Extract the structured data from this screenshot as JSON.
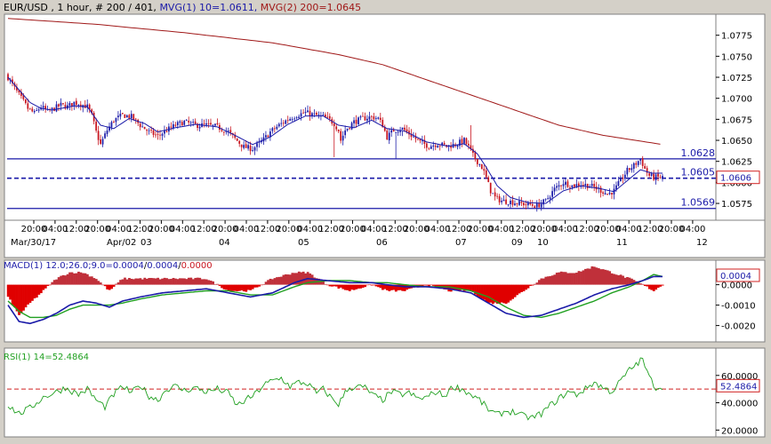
{
  "colors": {
    "frame": "#d4d0c8",
    "plot_bg": "#ffffff",
    "bull": "#1a1aa8",
    "bear": "#c8141e",
    "mvg1": "#1a1aa8",
    "mvg2": "#a01818",
    "hline": "#1a1aa8",
    "macd_line": "#1a1aa8",
    "signal_line": "#20a020",
    "hist_pos": "#c0303a",
    "hist_neg": "#e00000",
    "rsi_line": "#20a020",
    "rsi_ref": "#d02020",
    "title_black": "#000000",
    "title_blue": "#1a1aa8",
    "title_red": "#a01818"
  },
  "header": {
    "symbol_text": "EUR/USD , 1 hour, # 200 / 401, ",
    "mvg1_text": "MVG(1) 10=1.0611, ",
    "mvg2_text": "MVG(2) 200=1.0645"
  },
  "macd_header": {
    "prefix": "MACD(1) 12.0;26.0;9.0=",
    "macd_val": "0.0004",
    "sep": "/",
    "signal_val": "0.0004",
    "sep2": "/",
    "hist_val": "0.0000"
  },
  "rsi_header": {
    "text": "RSI(1) 14=52.4864"
  },
  "x_axis": {
    "time_labels": [
      "20:00",
      "04:00",
      "12:00",
      "20:00",
      "04:00",
      "12:00",
      "20:00",
      "04:00",
      "12:00",
      "20:00",
      "04:00",
      "12:00",
      "20:00",
      "04:00",
      "12:00",
      "20:00",
      "04:00",
      "12:00",
      "20:00",
      "04:00",
      "12:00",
      "20:00",
      "04:00",
      "12:00",
      "20:00",
      "04:00",
      "12:00",
      "20:00",
      "04:00",
      "12:00",
      "20:00",
      "04:00"
    ],
    "date_labels": [
      "Mar/30/17",
      "Apr/02",
      "03",
      "04",
      "05",
      "06",
      "07",
      "09",
      "10",
      "11",
      "12"
    ]
  },
  "chart_data": [
    {
      "type": "candlestick",
      "name": "EUR/USD",
      "ylim": [
        1.0555,
        1.08
      ],
      "yticks": [
        1.0575,
        1.06,
        1.0625,
        1.065,
        1.0675,
        1.07,
        1.0725,
        1.075,
        1.0775
      ],
      "ytick_labels": [
        "1.0575",
        "1.0600",
        "1.0625",
        "1.0650",
        "1.0675",
        "1.0700",
        "1.0725",
        "1.0750",
        "1.0775"
      ],
      "last_price": 1.0606,
      "last_price_label": "1.0606",
      "levels": [
        {
          "value": 1.0628,
          "label": "1.0628",
          "style": "solid"
        },
        {
          "value": 1.0605,
          "label": "1.0605",
          "style": "dashed"
        },
        {
          "value": 1.0569,
          "label": "1.0569",
          "style": "solid"
        }
      ],
      "close_path": [
        [
          0,
          1.0725
        ],
        [
          3,
          1.0712
        ],
        [
          6,
          1.07
        ],
        [
          9,
          1.0688
        ],
        [
          12,
          1.0682
        ],
        [
          15,
          1.069
        ],
        [
          18,
          1.0684
        ],
        [
          21,
          1.0688
        ],
        [
          24,
          1.0692
        ],
        [
          27,
          1.069
        ],
        [
          30,
          1.0695
        ],
        [
          33,
          1.0693
        ],
        [
          36,
          1.069
        ],
        [
          38,
          1.068
        ],
        [
          40,
          1.066
        ],
        [
          42,
          1.0645
        ],
        [
          45,
          1.0662
        ],
        [
          48,
          1.0674
        ],
        [
          52,
          1.068
        ],
        [
          56,
          1.0678
        ],
        [
          60,
          1.0668
        ],
        [
          64,
          1.066
        ],
        [
          68,
          1.0655
        ],
        [
          72,
          1.0662
        ],
        [
          76,
          1.0668
        ],
        [
          80,
          1.0672
        ],
        [
          85,
          1.0668
        ],
        [
          90,
          1.0668
        ],
        [
          95,
          1.0666
        ],
        [
          100,
          1.066
        ],
        [
          103,
          1.0652
        ],
        [
          107,
          1.0642
        ],
        [
          111,
          1.064
        ],
        [
          115,
          1.0648
        ],
        [
          119,
          1.066
        ],
        [
          123,
          1.0668
        ],
        [
          127,
          1.0675
        ],
        [
          131,
          1.068
        ],
        [
          135,
          1.0683
        ],
        [
          139,
          1.068
        ],
        [
          143,
          1.0678
        ],
        [
          146,
          1.0674
        ],
        [
          148,
          1.067
        ],
        [
          150,
          1.0662
        ],
        [
          151,
          1.065
        ],
        [
          153,
          1.0662
        ],
        [
          157,
          1.0672
        ],
        [
          161,
          1.0676
        ],
        [
          165,
          1.0678
        ],
        [
          168,
          1.0676
        ],
        [
          170,
          1.0668
        ],
        [
          172,
          1.0654
        ],
        [
          175,
          1.0662
        ],
        [
          179,
          1.0664
        ],
        [
          183,
          1.0656
        ],
        [
          187,
          1.0648
        ],
        [
          191,
          1.0643
        ],
        [
          195,
          1.0646
        ],
        [
          199,
          1.0643
        ],
        [
          203,
          1.0645
        ],
        [
          207,
          1.065
        ],
        [
          209,
          1.0642
        ],
        [
          211,
          1.0632
        ],
        [
          213,
          1.0625
        ],
        [
          215,
          1.0618
        ],
        [
          216,
          1.0612
        ],
        [
          217,
          1.0605
        ],
        [
          219,
          1.059
        ],
        [
          221,
          1.0582
        ],
        [
          224,
          1.0578
        ],
        [
          228,
          1.0577
        ],
        [
          232,
          1.0575
        ],
        [
          236,
          1.0574
        ],
        [
          240,
          1.0572
        ],
        [
          244,
          1.0578
        ],
        [
          248,
          1.0592
        ],
        [
          252,
          1.06
        ],
        [
          256,
          1.0596
        ],
        [
          260,
          1.0598
        ],
        [
          264,
          1.0596
        ],
        [
          268,
          1.0592
        ],
        [
          272,
          1.0586
        ],
        [
          275,
          1.059
        ],
        [
          278,
          1.0602
        ],
        [
          281,
          1.0614
        ],
        [
          284,
          1.062
        ],
        [
          287,
          1.0628
        ],
        [
          289,
          1.0616
        ],
        [
          291,
          1.0608
        ],
        [
          293,
          1.0606
        ],
        [
          295,
          1.0606
        ],
        [
          297,
          1.0606
        ]
      ],
      "mvg1_path": [
        [
          0,
          1.0725
        ],
        [
          5,
          1.071
        ],
        [
          10,
          1.0695
        ],
        [
          15,
          1.0688
        ],
        [
          20,
          1.0686
        ],
        [
          30,
          1.0691
        ],
        [
          36,
          1.069
        ],
        [
          42,
          1.0668
        ],
        [
          48,
          1.0664
        ],
        [
          55,
          1.0676
        ],
        [
          62,
          1.067
        ],
        [
          68,
          1.066
        ],
        [
          76,
          1.0665
        ],
        [
          85,
          1.0669
        ],
        [
          95,
          1.0666
        ],
        [
          103,
          1.0656
        ],
        [
          111,
          1.0645
        ],
        [
          119,
          1.0654
        ],
        [
          127,
          1.0669
        ],
        [
          135,
          1.0679
        ],
        [
          143,
          1.0679
        ],
        [
          150,
          1.0668
        ],
        [
          157,
          1.0665
        ],
        [
          165,
          1.0674
        ],
        [
          172,
          1.0664
        ],
        [
          180,
          1.0661
        ],
        [
          190,
          1.0648
        ],
        [
          200,
          1.0643
        ],
        [
          207,
          1.0646
        ],
        [
          213,
          1.0634
        ],
        [
          217,
          1.0618
        ],
        [
          222,
          1.0596
        ],
        [
          228,
          1.0582
        ],
        [
          236,
          1.0576
        ],
        [
          244,
          1.0575
        ],
        [
          252,
          1.059
        ],
        [
          260,
          1.0596
        ],
        [
          268,
          1.0593
        ],
        [
          275,
          1.0589
        ],
        [
          281,
          1.0602
        ],
        [
          287,
          1.0615
        ],
        [
          292,
          1.0611
        ],
        [
          297,
          1.0611
        ]
      ],
      "mvg2_path": [
        [
          0,
          1.0795
        ],
        [
          40,
          1.0788
        ],
        [
          80,
          1.0778
        ],
        [
          120,
          1.0766
        ],
        [
          150,
          1.0752
        ],
        [
          170,
          1.074
        ],
        [
          190,
          1.0722
        ],
        [
          210,
          1.0704
        ],
        [
          230,
          1.0686
        ],
        [
          250,
          1.0668
        ],
        [
          270,
          1.0656
        ],
        [
          297,
          1.0645
        ]
      ]
    },
    {
      "type": "macd",
      "name": "MACD(1) 12.0;26.0;9.0",
      "ylim": [
        -0.0028,
        0.0012
      ],
      "yticks": [
        -0.002,
        -0.001,
        0.0
      ],
      "ytick_labels": [
        "-0.0020",
        "-0.0010",
        "0.0000"
      ],
      "last_value_label": "0.0004",
      "macd_path": [
        [
          0,
          -0.001
        ],
        [
          5,
          -0.0018
        ],
        [
          10,
          -0.0019
        ],
        [
          16,
          -0.0017
        ],
        [
          22,
          -0.0014
        ],
        [
          28,
          -0.001
        ],
        [
          34,
          -0.0008
        ],
        [
          40,
          -0.0009
        ],
        [
          46,
          -0.0011
        ],
        [
          52,
          -0.0008
        ],
        [
          60,
          -0.0006
        ],
        [
          70,
          -0.0004
        ],
        [
          80,
          -0.0003
        ],
        [
          90,
          -0.0002
        ],
        [
          100,
          -0.0004
        ],
        [
          110,
          -0.0006
        ],
        [
          120,
          -0.0004
        ],
        [
          130,
          0.0001
        ],
        [
          136,
          0.0003
        ],
        [
          145,
          0.0002
        ],
        [
          155,
          0.0001
        ],
        [
          165,
          0.0001
        ],
        [
          172,
          0.0
        ],
        [
          180,
          -0.0001
        ],
        [
          190,
          -0.0001
        ],
        [
          200,
          -0.0002
        ],
        [
          210,
          -0.0004
        ],
        [
          218,
          -0.0009
        ],
        [
          226,
          -0.0014
        ],
        [
          234,
          -0.0016
        ],
        [
          242,
          -0.0015
        ],
        [
          250,
          -0.0012
        ],
        [
          258,
          -0.0009
        ],
        [
          266,
          -0.0005
        ],
        [
          274,
          -0.0002
        ],
        [
          282,
          0.0
        ],
        [
          288,
          0.0002
        ],
        [
          293,
          0.0004
        ],
        [
          297,
          0.0004
        ]
      ],
      "signal_path": [
        [
          0,
          -0.0008
        ],
        [
          5,
          -0.0013
        ],
        [
          10,
          -0.0016
        ],
        [
          16,
          -0.0016
        ],
        [
          22,
          -0.0015
        ],
        [
          28,
          -0.0012
        ],
        [
          34,
          -0.001
        ],
        [
          40,
          -0.001
        ],
        [
          46,
          -0.001
        ],
        [
          52,
          -0.0009
        ],
        [
          60,
          -0.0007
        ],
        [
          70,
          -0.0005
        ],
        [
          80,
          -0.0004
        ],
        [
          90,
          -0.0003
        ],
        [
          100,
          -0.0003
        ],
        [
          110,
          -0.0005
        ],
        [
          120,
          -0.0005
        ],
        [
          130,
          -0.0001
        ],
        [
          136,
          0.0001
        ],
        [
          145,
          0.0002
        ],
        [
          155,
          0.0002
        ],
        [
          165,
          0.0001
        ],
        [
          172,
          0.0001
        ],
        [
          180,
          0.0
        ],
        [
          190,
          -0.0001
        ],
        [
          200,
          -0.0001
        ],
        [
          210,
          -0.0003
        ],
        [
          218,
          -0.0006
        ],
        [
          226,
          -0.0011
        ],
        [
          234,
          -0.0015
        ],
        [
          242,
          -0.0016
        ],
        [
          250,
          -0.0014
        ],
        [
          258,
          -0.0011
        ],
        [
          266,
          -0.0008
        ],
        [
          274,
          -0.0004
        ],
        [
          282,
          -0.0001
        ],
        [
          288,
          0.0002
        ],
        [
          293,
          0.0005
        ],
        [
          297,
          0.0004
        ]
      ]
    },
    {
      "type": "rsi",
      "name": "RSI(1) 14",
      "ylim": [
        15,
        80
      ],
      "yticks": [
        20,
        40,
        60
      ],
      "ytick_labels": [
        "20.0000",
        "40.0000",
        "60.0000"
      ],
      "reference_level": 50,
      "last_value": 52.4864,
      "last_value_label": "52.4864",
      "rsi_path": [
        [
          0,
          38
        ],
        [
          5,
          32
        ],
        [
          10,
          36
        ],
        [
          16,
          44
        ],
        [
          22,
          48
        ],
        [
          26,
          51
        ],
        [
          32,
          46
        ],
        [
          36,
          50
        ],
        [
          40,
          42
        ],
        [
          44,
          37
        ],
        [
          48,
          46
        ],
        [
          52,
          52
        ],
        [
          56,
          47
        ],
        [
          60,
          53
        ],
        [
          64,
          45
        ],
        [
          68,
          42
        ],
        [
          72,
          50
        ],
        [
          76,
          52
        ],
        [
          80,
          49
        ],
        [
          85,
          51
        ],
        [
          90,
          48
        ],
        [
          95,
          50
        ],
        [
          100,
          47
        ],
        [
          104,
          38
        ],
        [
          108,
          42
        ],
        [
          112,
          46
        ],
        [
          116,
          53
        ],
        [
          120,
          56
        ],
        [
          124,
          58
        ],
        [
          128,
          52
        ],
        [
          132,
          55
        ],
        [
          136,
          54
        ],
        [
          140,
          47
        ],
        [
          143,
          50
        ],
        [
          147,
          43
        ],
        [
          150,
          39
        ],
        [
          154,
          50
        ],
        [
          158,
          52
        ],
        [
          162,
          51
        ],
        [
          166,
          45
        ],
        [
          170,
          42
        ],
        [
          174,
          48
        ],
        [
          178,
          46
        ],
        [
          182,
          47
        ],
        [
          186,
          43
        ],
        [
          190,
          44
        ],
        [
          194,
          48
        ],
        [
          198,
          45
        ],
        [
          202,
          52
        ],
        [
          206,
          50
        ],
        [
          210,
          46
        ],
        [
          214,
          42
        ],
        [
          218,
          35
        ],
        [
          222,
          31
        ],
        [
          226,
          34
        ],
        [
          230,
          33
        ],
        [
          234,
          30
        ],
        [
          238,
          29
        ],
        [
          242,
          32
        ],
        [
          246,
          38
        ],
        [
          250,
          43
        ],
        [
          254,
          48
        ],
        [
          258,
          46
        ],
        [
          262,
          50
        ],
        [
          266,
          55
        ],
        [
          270,
          51
        ],
        [
          274,
          48
        ],
        [
          278,
          56
        ],
        [
          282,
          64
        ],
        [
          285,
          68
        ],
        [
          288,
          72
        ],
        [
          290,
          62
        ],
        [
          292,
          56
        ],
        [
          294,
          51
        ],
        [
          297,
          52
        ]
      ]
    }
  ]
}
